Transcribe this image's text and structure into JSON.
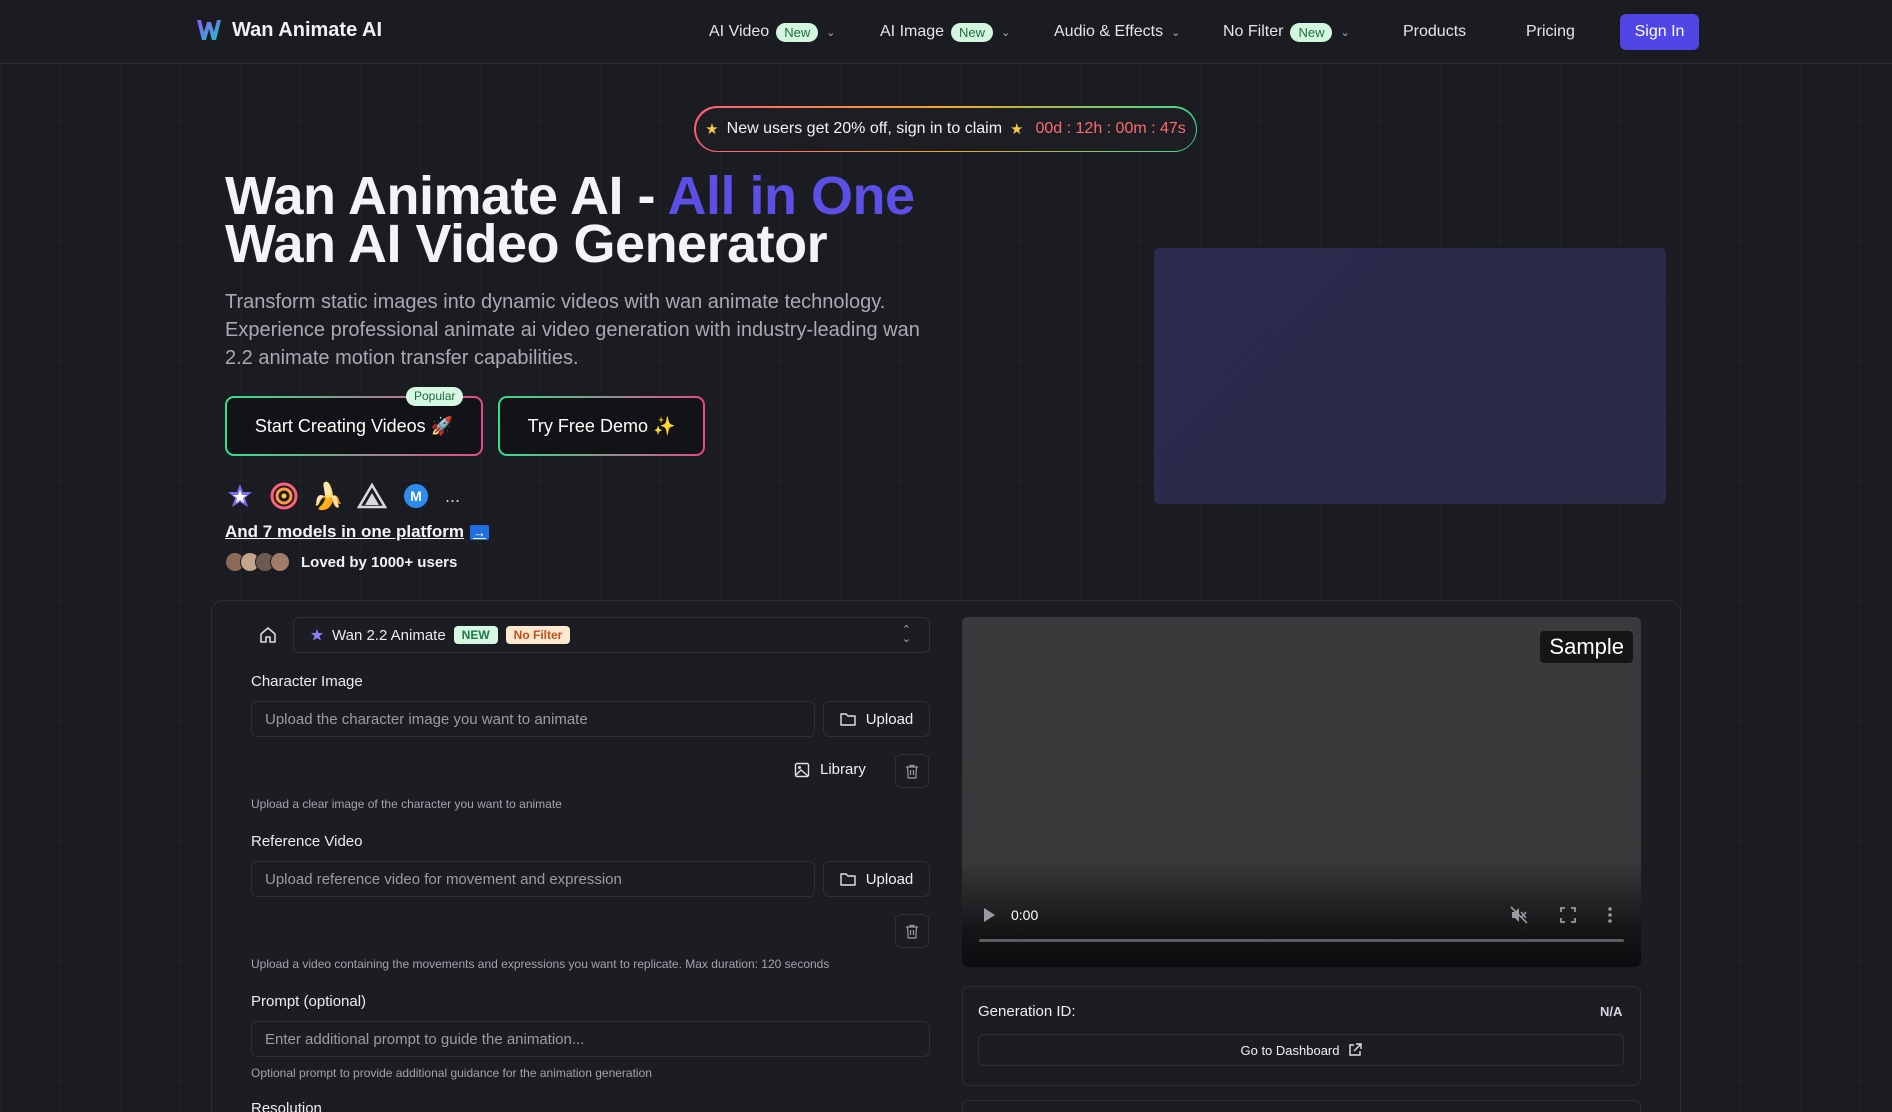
{
  "nav": {
    "brand": "Wan Animate AI",
    "items": [
      {
        "label": "AI Video",
        "badge": "New",
        "has_dropdown": true
      },
      {
        "label": "AI Image",
        "badge": "New",
        "has_dropdown": true
      },
      {
        "label": "Audio & Effects",
        "has_dropdown": true
      },
      {
        "label": "No Filter",
        "badge": "New",
        "has_dropdown": true
      },
      {
        "label": "Products"
      },
      {
        "label": "Pricing"
      }
    ],
    "signin": "Sign In"
  },
  "promo": {
    "text": "New users get 20% off, sign in to claim",
    "countdown": "00d : 12h : 00m : 47s"
  },
  "hero": {
    "title_part1": "Wan Animate AI - ",
    "title_accent": "All in One",
    "title_part2": "Wan AI Video Generator",
    "subtitle": "Transform static images into dynamic videos with wan animate technology. Experience professional animate ai video generation with industry-leading wan 2.2 animate motion transfer capabilities.",
    "cta_primary": "Start Creating Videos 🚀",
    "cta_primary_badge": "Popular",
    "cta_secondary": "Try Free Demo ✨",
    "models_more": "...",
    "models_link": "And 7 models in one platform",
    "models_arrow": "→",
    "loved": "Loved by 1000+ users"
  },
  "form": {
    "model_name": "Wan 2.2 Animate",
    "model_badge_new": "NEW",
    "model_badge_filter": "No Filter",
    "character_label": "Character Image",
    "character_placeholder": "Upload the character image you want to animate",
    "upload": "Upload",
    "library": "Library",
    "character_help": "Upload a clear image of the character you want to animate",
    "reference_label": "Reference Video",
    "reference_placeholder": "Upload reference video for movement and expression",
    "reference_help": "Upload a video containing the movements and expressions you want to replicate. Max duration: 120 seconds",
    "prompt_label": "Prompt (optional)",
    "prompt_placeholder": "Enter additional prompt to guide the animation...",
    "prompt_help": "Optional prompt to provide additional guidance for the animation generation",
    "resolution_label": "Resolution"
  },
  "preview": {
    "sample": "Sample",
    "time": "0:00",
    "generation_label": "Generation ID:",
    "generation_value": "N/A",
    "dashboard": "Go to Dashboard"
  },
  "colors": {
    "accent": "#5b4fe6",
    "signin": "#4f46e5",
    "background": "#1b1c21",
    "countdown": "#ff6a6a"
  },
  "icons": [
    "logo-w-icon",
    "chevron-down-icon",
    "star-icon",
    "rocket-icon",
    "sparkles-icon",
    "model-icons",
    "home-icon",
    "up-down-icon",
    "folder-icon",
    "image-icon",
    "trash-icon",
    "play-icon",
    "mute-icon",
    "fullscreen-icon",
    "more-icon",
    "external-link-icon"
  ]
}
